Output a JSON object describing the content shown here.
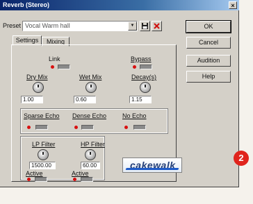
{
  "window": {
    "title": "Reverb (Stereo)",
    "close_symbol": "×"
  },
  "preset": {
    "label": "Preset",
    "value": "Vocal Warm hall"
  },
  "buttons": {
    "ok": "OK",
    "cancel": "Cancel",
    "audition": "Audition",
    "help": "Help"
  },
  "tabs": [
    {
      "label": "Settings"
    },
    {
      "label": "Mixing"
    }
  ],
  "link": {
    "label": "Link"
  },
  "bypass": {
    "label": "Bypass"
  },
  "dry_mix": {
    "label": "Dry Mix",
    "value": "1.00"
  },
  "wet_mix": {
    "label": "Wet Mix",
    "value": "0.60"
  },
  "decay": {
    "label": "Decay(s)",
    "value": "1.15"
  },
  "echo": {
    "sparse": "Sparse Echo",
    "dense": "Dense Echo",
    "none": "No Echo"
  },
  "lp_filter": {
    "label": "LP Filter",
    "value": "1500.00",
    "active_label": "Active"
  },
  "hp_filter": {
    "label": "HP Filter",
    "value": "60.00",
    "active_label": "Active"
  },
  "logo": {
    "text": "cakewalk"
  },
  "badge": {
    "number": "2"
  },
  "colors": {
    "led": "#d81010",
    "titlebar": "#0a246a",
    "badge": "#e0241c"
  },
  "icons": [
    "save-icon",
    "delete-icon",
    "chevron-down-icon",
    "close-icon"
  ]
}
